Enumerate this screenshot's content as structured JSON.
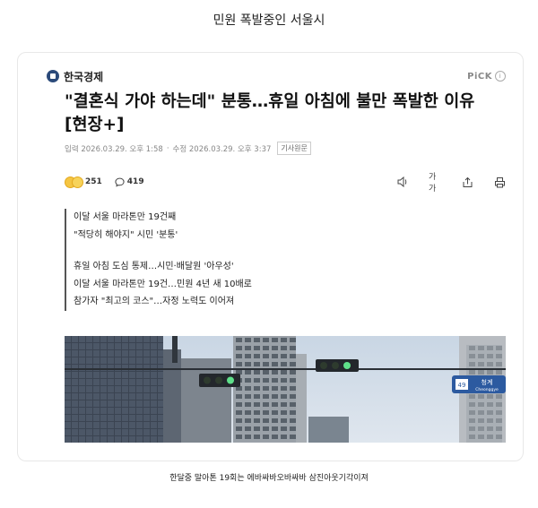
{
  "page": {
    "header_title": "민원 폭발중인 서울시"
  },
  "article": {
    "publisher": "한국경제",
    "pick_label": "PiCK",
    "title": "\"결혼식 가야 하는데\" 분통…휴일 아침에 불만 폭발한 이유 [현장+]",
    "meta": {
      "posted": "입력 2026.03.29. 오후 1:58",
      "updated": "수정 2026.03.29. 오후 3:37",
      "source_tag": "기사원문"
    },
    "reactions": {
      "count": "251",
      "comments": "419"
    },
    "tools": [
      "speaker-icon",
      "font-size-icon",
      "share-icon",
      "print-icon"
    ],
    "font_size_label": "가가",
    "summary": [
      "이달 서울 마라톤만 19건째",
      "\"적당히 해야지\" 시민 '분통'",
      "휴일 아침 도심 통제…시민·배달원 '아우성'",
      "이달 서울 마라톤만 19건…민원 4년 새 10배로",
      "참가자 \"최고의 코스\"…자정 노력도 이어져"
    ],
    "photo": {
      "sign_number": "49",
      "sign_text": "청계",
      "sign_subtext": "Cheonggye"
    }
  },
  "caption": "한달중 말아톤 19회는 에바싸바오바싸바 삼진아웃기각이져",
  "colors": {
    "publisher_logo": "#2b4a7a",
    "title": "#111111",
    "muted": "#888888"
  }
}
